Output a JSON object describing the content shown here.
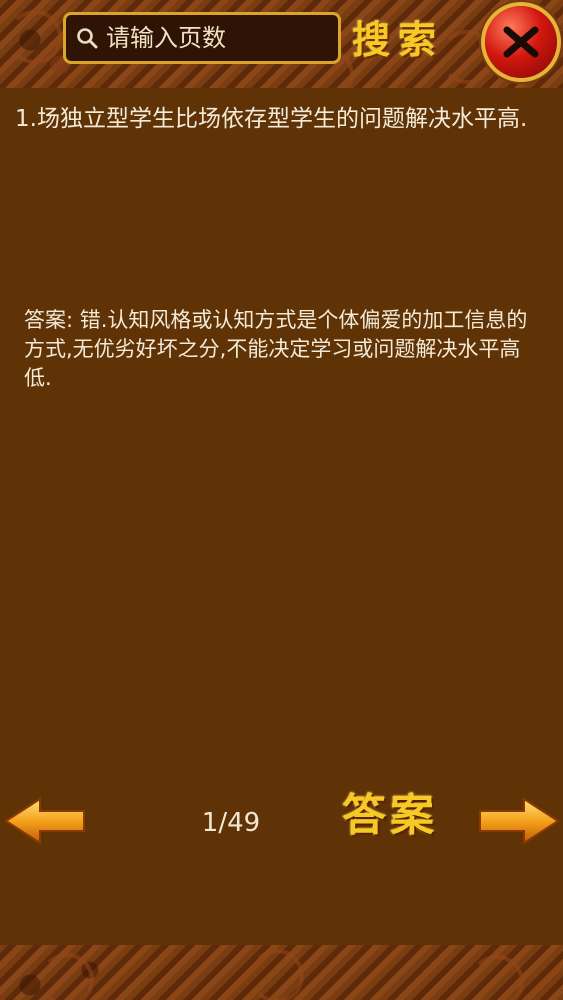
{
  "search": {
    "placeholder": "请输入页数",
    "button_label": "搜索"
  },
  "question": {
    "text": "1.场独立型学生比场依存型学生的问题解决水平高."
  },
  "answer": {
    "text": "答案: 错.认知风格或认知方式是个体偏爱的加工信息的方式,无优劣好坏之分,不能决定学习或问题解决水平高低."
  },
  "pagination": {
    "counter": "1/49"
  },
  "answer_button_label": "答案",
  "icons": {
    "search": "magnifier-icon",
    "close": "close-icon",
    "prev": "arrow-left-icon",
    "next": "arrow-right-icon"
  },
  "colors": {
    "background": "#603306",
    "text": "#f3ead8",
    "accent_gold": "#f7c925",
    "close_red": "#d2160f"
  }
}
